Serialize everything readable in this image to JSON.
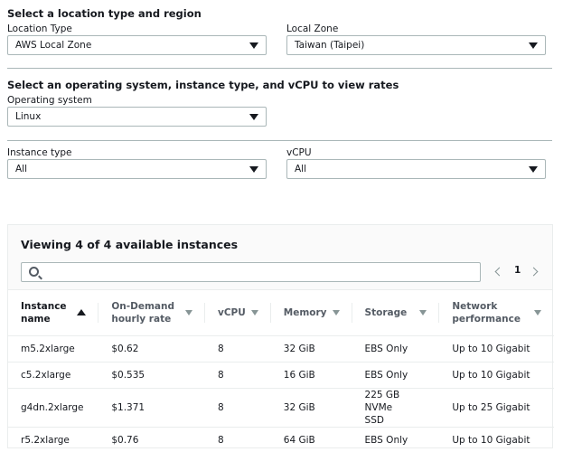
{
  "location_section": {
    "title": "Select a location type and region",
    "location_type_label": "Location Type",
    "location_type_value": "AWS Local Zone",
    "local_zone_label": "Local Zone",
    "local_zone_value": "Taiwan (Taipei)"
  },
  "os_section": {
    "title": "Select an operating system, instance type, and vCPU to view rates",
    "os_label": "Operating system",
    "os_value": "Linux",
    "instance_type_label": "Instance type",
    "instance_type_value": "All",
    "vcpu_label": "vCPU",
    "vcpu_value": "All"
  },
  "results": {
    "title": "Viewing 4 of 4 available instances",
    "search_placeholder": "",
    "page": "1",
    "columns": [
      {
        "l1": "Instance",
        "l2": "name"
      },
      {
        "l1": "On-Demand",
        "l2": "hourly rate"
      },
      {
        "l1": "vCPU",
        "l2": ""
      },
      {
        "l1": "Memory",
        "l2": ""
      },
      {
        "l1": "Storage",
        "l2": ""
      },
      {
        "l1": "Network",
        "l2": "performance"
      }
    ],
    "rows": [
      {
        "name": "m5.2xlarge",
        "rate": "$0.62",
        "vcpu": "8",
        "memory": "32 GiB",
        "storage_l1": "EBS Only",
        "storage_l2": "",
        "network": "Up to 10 Gigabit"
      },
      {
        "name": "c5.2xlarge",
        "rate": "$0.535",
        "vcpu": "8",
        "memory": "16 GiB",
        "storage_l1": "EBS Only",
        "storage_l2": "",
        "network": "Up to 10 Gigabit"
      },
      {
        "name": "g4dn.2xlarge",
        "rate": "$1.371",
        "vcpu": "8",
        "memory": "32 GiB",
        "storage_l1": "225 GB NVMe",
        "storage_l2": "SSD",
        "network": "Up to 25 Gigabit"
      },
      {
        "name": "r5.2xlarge",
        "rate": "$0.76",
        "vcpu": "8",
        "memory": "64 GiB",
        "storage_l1": "EBS Only",
        "storage_l2": "",
        "network": "Up to 10 Gigabit"
      }
    ]
  }
}
